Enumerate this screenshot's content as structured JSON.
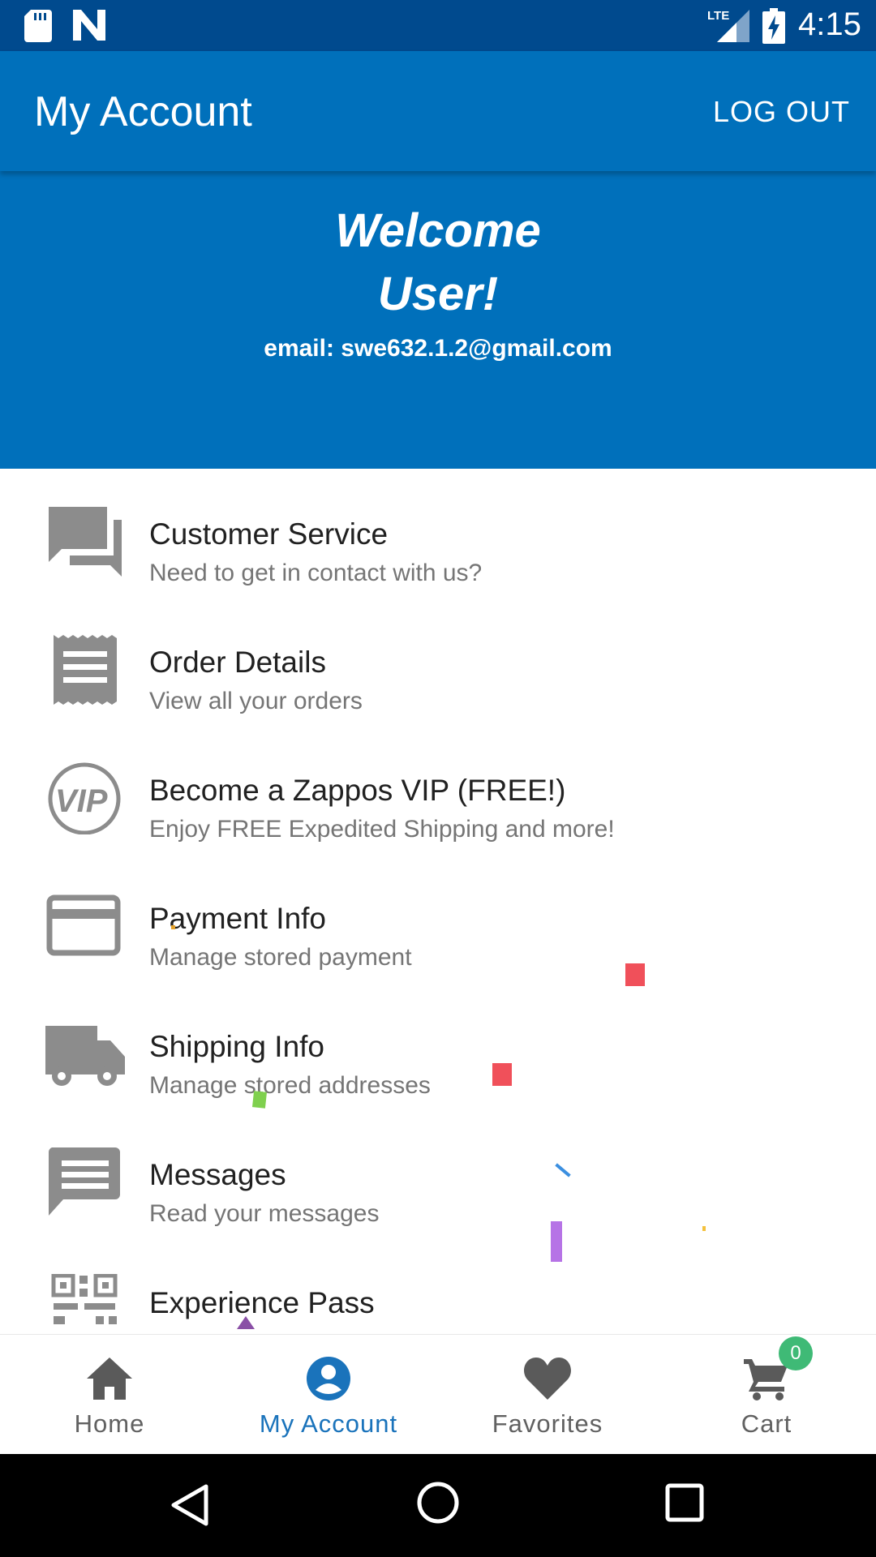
{
  "status_bar": {
    "network": "LTE",
    "time": "4:15",
    "icons": [
      "sd-card-icon",
      "n-logo-icon",
      "lte-signal-icon",
      "battery-charging-icon"
    ]
  },
  "app_bar": {
    "title": "My Account",
    "logout_label": "LOG OUT"
  },
  "welcome": {
    "line1": "Welcome",
    "line2": "User!",
    "email": "email: swe632.1.2@gmail.com"
  },
  "menu": {
    "items": [
      {
        "icon": "chat-icon",
        "label": "Customer Service",
        "sub": "Need to get in contact with us?"
      },
      {
        "icon": "receipt-icon",
        "label": "Order Details",
        "sub": "View all your orders"
      },
      {
        "icon": "vip-icon",
        "label": "Become a Zappos VIP (FREE!)",
        "sub": "Enjoy FREE Expedited Shipping and more!"
      },
      {
        "icon": "credit-card-icon",
        "label": "Payment Info",
        "sub": "Manage stored payment"
      },
      {
        "icon": "truck-icon",
        "label": "Shipping Info",
        "sub": "Manage stored addresses"
      },
      {
        "icon": "message-icon",
        "label": "Messages",
        "sub": "Read your messages"
      },
      {
        "icon": "qr-code-icon",
        "label": "Experience Pass",
        "sub": ""
      }
    ]
  },
  "bottom_nav": {
    "tabs": [
      {
        "icon": "home-icon",
        "label": "Home"
      },
      {
        "icon": "account-icon",
        "label": "My Account"
      },
      {
        "icon": "heart-icon",
        "label": "Favorites"
      },
      {
        "icon": "cart-icon",
        "label": "Cart"
      }
    ],
    "active_tab": "My Account",
    "cart_badge": "0"
  },
  "colors": {
    "status_bar": "#004a8e",
    "primary": "#0070bb",
    "icon_gray": "#8c8c8c",
    "active_tab": "#1a73bb",
    "badge": "#3fba76"
  }
}
